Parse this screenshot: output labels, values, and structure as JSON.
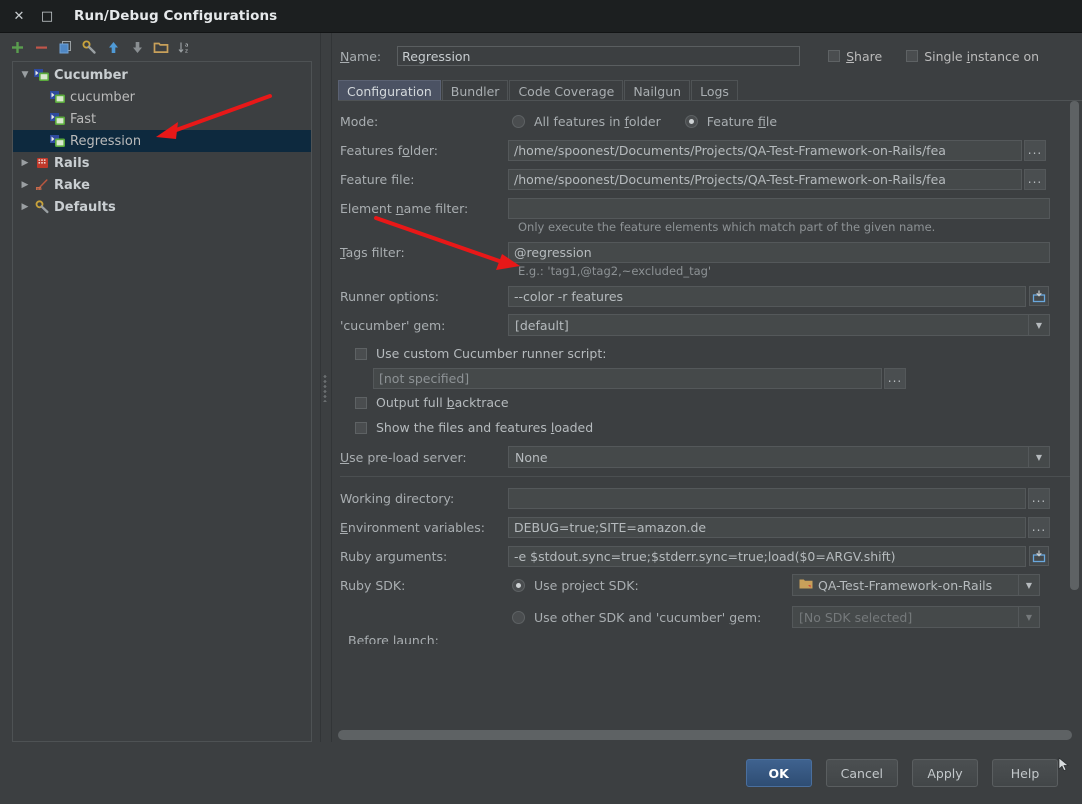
{
  "window": {
    "title": "Run/Debug Configurations",
    "close_icon": "close-icon",
    "maximize_icon": "maximize-icon"
  },
  "left_panel": {
    "toolbar": [
      {
        "name": "add-configuration-button",
        "icon": "plus-icon",
        "color": "#5a9e4f"
      },
      {
        "name": "remove-configuration-button",
        "icon": "minus-icon",
        "color": "#c0564a"
      },
      {
        "name": "copy-configuration-button",
        "icon": "copy-icon",
        "color": "#4f87c4"
      },
      {
        "name": "edit-defaults-button",
        "icon": "wrench-icon",
        "color": "#c9a33b"
      },
      {
        "name": "move-up-button",
        "icon": "arrow-up-icon",
        "color": "#4f87c4"
      },
      {
        "name": "move-down-button",
        "icon": "arrow-down-icon",
        "color": "#8a8f92"
      },
      {
        "name": "move-into-folder-button",
        "icon": "folder-icon",
        "color": "#c8a05a"
      },
      {
        "name": "sort-alphabetically-button",
        "icon": "sort-az-icon",
        "color": "#9a9fa2"
      }
    ],
    "tree": [
      {
        "label": "Cucumber",
        "level": 1,
        "expanded": true,
        "twisty": "▼",
        "icon": "cucumber-group-icon",
        "bold": true,
        "selected": false
      },
      {
        "label": "cucumber",
        "level": 2,
        "expanded": null,
        "twisty": "",
        "icon": "cucumber-config-icon",
        "bold": false,
        "selected": false
      },
      {
        "label": "Fast",
        "level": 2,
        "expanded": null,
        "twisty": "",
        "icon": "cucumber-config-icon",
        "bold": false,
        "selected": false
      },
      {
        "label": "Regression",
        "level": 2,
        "expanded": null,
        "twisty": "",
        "icon": "cucumber-config-icon",
        "bold": false,
        "selected": true
      },
      {
        "label": "Rails",
        "level": 1,
        "expanded": false,
        "twisty": "▶",
        "icon": "rails-icon",
        "bold": true,
        "selected": false
      },
      {
        "label": "Rake",
        "level": 1,
        "expanded": false,
        "twisty": "▶",
        "icon": "rake-icon",
        "bold": true,
        "selected": false
      },
      {
        "label": "Defaults",
        "level": 1,
        "expanded": false,
        "twisty": "▶",
        "icon": "wrench-icon",
        "bold": true,
        "selected": false
      }
    ]
  },
  "form": {
    "name_label": "Name:",
    "name_value": "Regression",
    "share_label": "Share",
    "share_checked": false,
    "single_instance_label": "Single instance on",
    "single_instance_checked": false,
    "tabs": [
      {
        "label": "Configuration",
        "active": true
      },
      {
        "label": "Bundler",
        "active": false
      },
      {
        "label": "Code Coverage",
        "active": false
      },
      {
        "label": "Nailgun",
        "active": false
      },
      {
        "label": "Logs",
        "active": false
      }
    ],
    "mode_label": "Mode:",
    "mode_option_folder": "All features in folder",
    "mode_option_file": "Feature file",
    "mode_selected": "Feature file",
    "features_folder_label": "Features folder:",
    "features_folder_value": "/home/spoonest/Documents/Projects/QA-Test-Framework-on-Rails/fea",
    "feature_file_label": "Feature file:",
    "feature_file_value": "/home/spoonest/Documents/Projects/QA-Test-Framework-on-Rails/fea",
    "element_name_filter_label": "Element name filter:",
    "element_name_filter_value": "",
    "element_name_filter_hint": "Only execute the feature elements which match part of the given name.",
    "tags_filter_label": "Tags filter:",
    "tags_filter_value": "@regression",
    "tags_filter_hint": "E.g.: 'tag1,@tag2,~excluded_tag'",
    "runner_options_label": "Runner options:",
    "runner_options_value": "--color -r features",
    "cucumber_gem_label": "'cucumber' gem:",
    "cucumber_gem_value": "[default]",
    "use_custom_runner_label": "Use custom Cucumber runner script:",
    "use_custom_runner_checked": false,
    "custom_runner_value": "[not specified]",
    "output_backtrace_label": "Output full backtrace",
    "output_backtrace_checked": false,
    "show_files_label": "Show the files and features loaded",
    "show_files_checked": false,
    "preload_server_label": "Use pre-load server:",
    "preload_server_value": "None",
    "working_directory_label": "Working directory:",
    "working_directory_value": "",
    "env_vars_label": "Environment variables:",
    "env_vars_value": "DEBUG=true;SITE=amazon.de",
    "ruby_arguments_label": "Ruby arguments:",
    "ruby_arguments_value": "-e $stdout.sync=true;$stderr.sync=true;load($0=ARGV.shift)",
    "ruby_sdk_label": "Ruby SDK:",
    "use_project_sdk_label": "Use project SDK:",
    "use_project_sdk_selected": true,
    "project_sdk_value": "QA-Test-Framework-on-Rails",
    "use_other_sdk_label": "Use other SDK and 'cucumber' gem:",
    "use_other_sdk_selected": false,
    "other_sdk_value": "[No SDK selected]",
    "ellipsis_label": "...",
    "dropdown_arrow": "▼",
    "clipped_section_label": "Before launch:"
  },
  "buttons": [
    {
      "label": "OK",
      "name": "ok-button",
      "default": true
    },
    {
      "label": "Cancel",
      "name": "cancel-button",
      "default": false
    },
    {
      "label": "Apply",
      "name": "apply-button",
      "default": false
    },
    {
      "label": "Help",
      "name": "help-button",
      "default": false
    }
  ],
  "annotations": {
    "arrow_color": "#e81818",
    "arrow_1_target": "Regression tree item",
    "arrow_2_target": "Tags filter field"
  }
}
